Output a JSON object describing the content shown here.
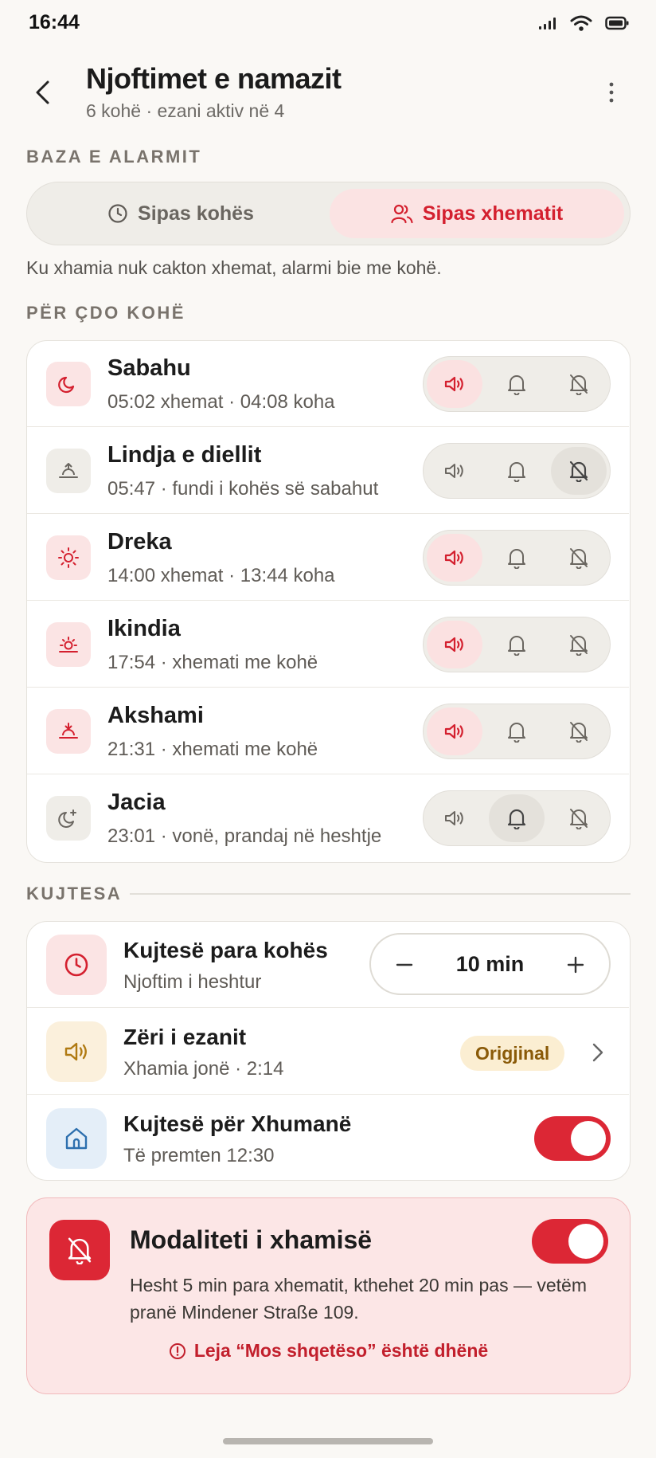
{
  "status_bar": {
    "time": "16:44"
  },
  "header": {
    "title": "Njoftimet e namazit",
    "subtitle": "6 kohë · ezani aktiv në 4"
  },
  "alarm_base": {
    "section_label": "BAZA E ALARMIT",
    "options": [
      {
        "label": "Sipas kohës",
        "icon": "clock-icon",
        "selected": false
      },
      {
        "label": "Sipas xhematit",
        "icon": "users-icon",
        "selected": true
      }
    ],
    "info": "Ku xhamia nuk cakton xhemat, alarmi bie me kohë."
  },
  "per_prayer": {
    "section_label": "PËR ÇDO KOHË",
    "prayers": [
      {
        "name": "Sabahu",
        "detail": "05:02 xhemat · 04:08 koha",
        "icon": "moon-icon",
        "mode": "sound"
      },
      {
        "name": "Lindja e diellit",
        "detail": "05:47 · fundi i kohës së sabahut",
        "icon": "sunrise-icon",
        "mode": "off"
      },
      {
        "name": "Dreka",
        "detail": "14:00 xhemat · 13:44 koha",
        "icon": "sun-icon",
        "mode": "sound"
      },
      {
        "name": "Ikindia",
        "detail": "17:54 · xhemati me kohë",
        "icon": "sun-low-icon",
        "mode": "sound"
      },
      {
        "name": "Akshami",
        "detail": "21:31 · xhemati me kohë",
        "icon": "sunset-icon",
        "mode": "sound"
      },
      {
        "name": "Jacia",
        "detail": "23:01 · vonë, prandaj në heshtje",
        "icon": "moon-star-icon",
        "mode": "notify"
      }
    ]
  },
  "reminders": {
    "section_label": "KUJTESA",
    "before_time": {
      "title": "Kujtesë para kohës",
      "subtitle": "Njoftim i heshtur",
      "value": "10 min"
    },
    "adhan_voice": {
      "title": "Zëri i ezanit",
      "subtitle": "Xhamia jonë · 2:14",
      "badge": "Origjinal"
    },
    "friday": {
      "title": "Kujtesë për Xhumanë",
      "subtitle": "Të premten 12:30",
      "enabled": true
    }
  },
  "mosque_mode": {
    "title": "Modaliteti i xhamisë",
    "description": "Hesht 5 min para xhematit, kthehet 20 min pas — vetëm pranë Mindener Straße 109.",
    "warning": "Leja “Mos shqetëso” është dhënë",
    "enabled": true
  },
  "colors": {
    "accent": "#dc2735",
    "accent_soft": "#fbe4e4",
    "background": "#faf8f5"
  }
}
